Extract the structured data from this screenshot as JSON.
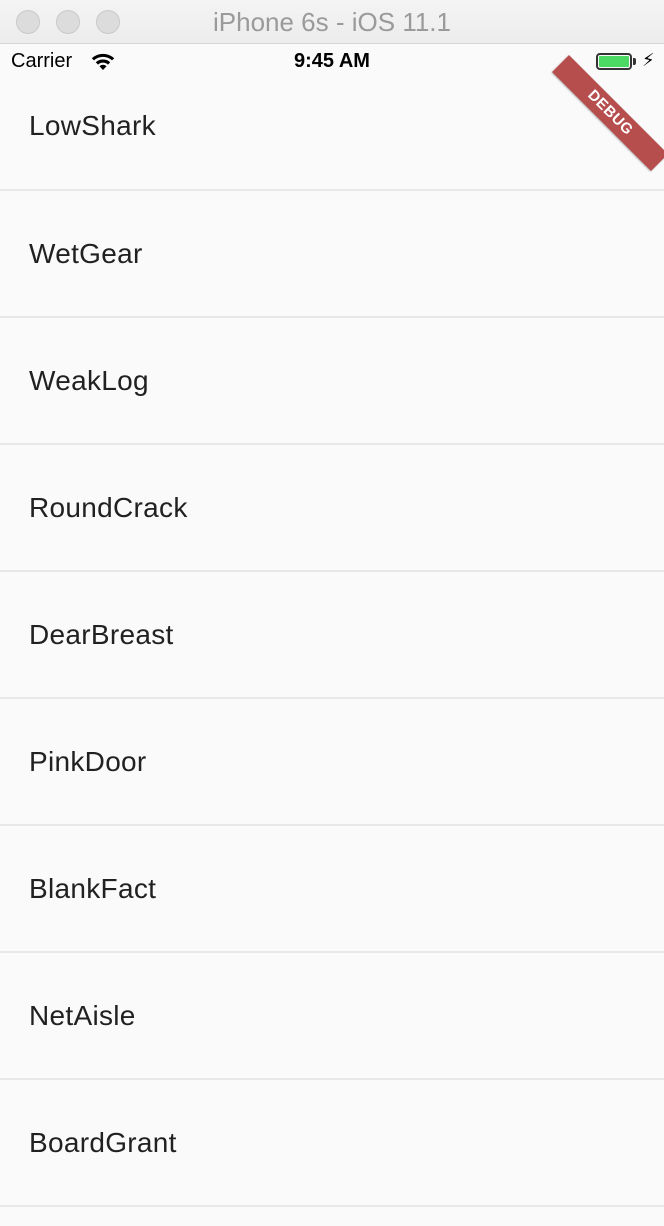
{
  "window": {
    "title": "iPhone 6s - iOS 11.1"
  },
  "status_bar": {
    "carrier": "Carrier",
    "time": "9:45 AM",
    "battery_level": 1.0,
    "battery_color": "#4cd964",
    "charging_icon": "bolt-icon",
    "wifi_icon": "wifi-icon"
  },
  "debug_banner": {
    "label": "DEBUG",
    "color": "#a01414"
  },
  "list": {
    "items": [
      {
        "label": "LowShark"
      },
      {
        "label": "WetGear"
      },
      {
        "label": "WeakLog"
      },
      {
        "label": "RoundCrack"
      },
      {
        "label": "DearBreast"
      },
      {
        "label": "PinkDoor"
      },
      {
        "label": "BlankFact"
      },
      {
        "label": "NetAisle"
      },
      {
        "label": "BoardGrant"
      }
    ]
  }
}
